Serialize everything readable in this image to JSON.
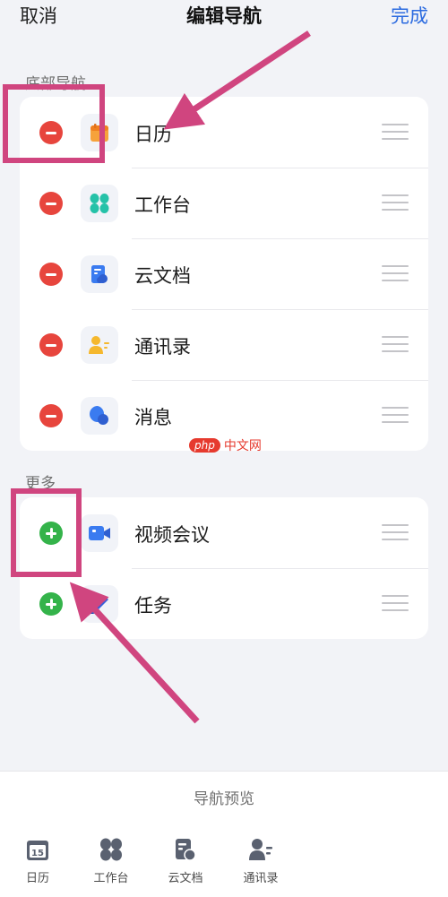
{
  "header": {
    "cancel": "取消",
    "title": "编辑导航",
    "done": "完成"
  },
  "sections": {
    "bottom_nav": {
      "label": "底部导航",
      "items": [
        {
          "label": "日历",
          "icon": "calendar-icon"
        },
        {
          "label": "工作台",
          "icon": "workbench-icon"
        },
        {
          "label": "云文档",
          "icon": "cloud-doc-icon"
        },
        {
          "label": "通讯录",
          "icon": "contacts-icon"
        },
        {
          "label": "消息",
          "icon": "message-icon"
        }
      ]
    },
    "more": {
      "label": "更多",
      "items": [
        {
          "label": "视频会议",
          "icon": "video-meeting-icon"
        },
        {
          "label": "任务",
          "icon": "task-icon"
        }
      ]
    }
  },
  "watermark": {
    "badge": "php",
    "text": "中文网"
  },
  "preview": {
    "title": "导航预览",
    "tabs": [
      {
        "label": "日历",
        "icon": "calendar-icon",
        "date": "15"
      },
      {
        "label": "工作台",
        "icon": "workbench-icon"
      },
      {
        "label": "云文档",
        "icon": "cloud-doc-icon"
      },
      {
        "label": "通讯录",
        "icon": "contacts-icon"
      }
    ]
  },
  "colors": {
    "accent": "#2c6be0",
    "remove": "#e7453d",
    "add": "#34b34a",
    "annotation": "#d0457f",
    "background": "#f2f3f7"
  }
}
